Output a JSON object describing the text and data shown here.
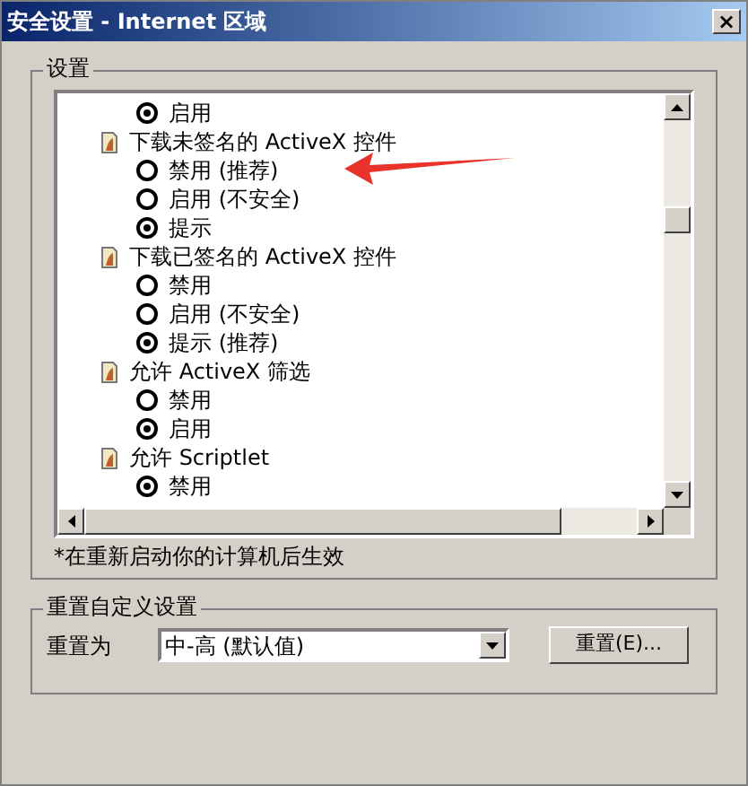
{
  "window": {
    "title": "安全设置 - Internet 区域",
    "close": "×"
  },
  "settings_group": {
    "legend": "设置",
    "items": [
      {
        "kind": "option",
        "label": "启用",
        "selected": true
      },
      {
        "kind": "group",
        "label": "下载未签名的 ActiveX 控件",
        "children": [
          {
            "kind": "option",
            "label": "禁用 (推荐)",
            "selected": false
          },
          {
            "kind": "option",
            "label": "启用 (不安全)",
            "selected": false
          },
          {
            "kind": "option",
            "label": "提示",
            "selected": true
          }
        ]
      },
      {
        "kind": "group",
        "label": "下载已签名的 ActiveX 控件",
        "children": [
          {
            "kind": "option",
            "label": "禁用",
            "selected": false
          },
          {
            "kind": "option",
            "label": "启用 (不安全)",
            "selected": false
          },
          {
            "kind": "option",
            "label": "提示 (推荐)",
            "selected": true
          }
        ]
      },
      {
        "kind": "group",
        "label": "允许 ActiveX 筛选",
        "children": [
          {
            "kind": "option",
            "label": "禁用",
            "selected": false
          },
          {
            "kind": "option",
            "label": "启用",
            "selected": true
          }
        ]
      },
      {
        "kind": "group",
        "label": "允许 Scriptlet",
        "children": [
          {
            "kind": "option",
            "label": "禁用",
            "selected": true
          }
        ]
      }
    ],
    "note": "*在重新启动你的计算机后生效"
  },
  "reset_group": {
    "legend": "重置自定义设置",
    "label": "重置为",
    "dropdown_value": "中-高 (默认值)",
    "button": "重置(E)..."
  }
}
